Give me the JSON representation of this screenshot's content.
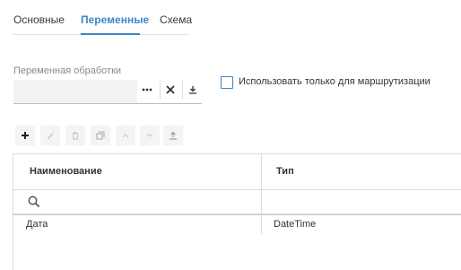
{
  "tabs": [
    {
      "label": "Основные",
      "active": false
    },
    {
      "label": "Переменные",
      "active": true
    },
    {
      "label": "Схема",
      "active": false
    }
  ],
  "variable_field": {
    "label": "Переменная обработки",
    "value": "",
    "buttons": [
      {
        "icon": "more-icon",
        "glyph": "•••"
      },
      {
        "icon": "close-icon",
        "glyph": "✕"
      },
      {
        "icon": "download-icon",
        "glyph": "⤓"
      }
    ]
  },
  "routing_checkbox": {
    "label": "Использовать только для маршрутизации",
    "checked": false
  },
  "toolbar": [
    {
      "icon": "add-icon",
      "enabled": true
    },
    {
      "icon": "edit-icon",
      "enabled": false
    },
    {
      "icon": "delete-icon",
      "enabled": false
    },
    {
      "icon": "copy-icon",
      "enabled": false
    },
    {
      "icon": "move-up-icon",
      "enabled": false
    },
    {
      "icon": "move-down-icon",
      "enabled": false
    },
    {
      "icon": "upload-icon",
      "enabled": false
    }
  ],
  "table": {
    "columns": [
      "Наименование",
      "Тип"
    ],
    "filter": {
      "icon": "search-icon"
    },
    "rows": [
      [
        "Дата",
        "DateTime"
      ]
    ]
  },
  "colors": {
    "accent": "#3e86c7",
    "text": "#333333",
    "muted": "#8a8a8a",
    "border": "#dcdcdc"
  }
}
